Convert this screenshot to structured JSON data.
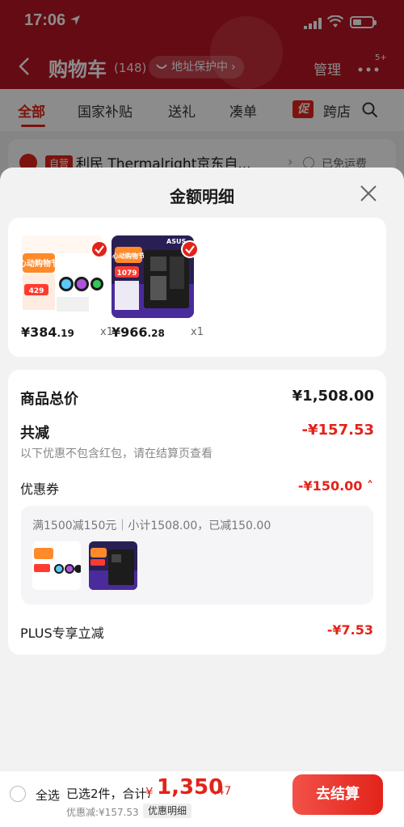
{
  "status_bar": {
    "time": "17:06"
  },
  "nav": {
    "title": "购物车",
    "count": "(148)",
    "address_label": "地址保护中",
    "manage_label": "管理",
    "more_badge": "5+"
  },
  "tabs": [
    {
      "label": "全部"
    },
    {
      "label": "国家补贴"
    },
    {
      "label": "送礼"
    },
    {
      "label": "凑单"
    },
    {
      "label": "跨店"
    }
  ],
  "promo_badge": "促",
  "store": {
    "badge": "自营",
    "name": "利民 Thermalright京东自...",
    "shipping": "已免运费"
  },
  "sheet": {
    "title": "金额明细",
    "products": [
      {
        "name": "Thermalright cooler",
        "price_int": "¥384",
        "price_dec": ".19",
        "qty": "x1",
        "img_price": "429",
        "promo": "心动购物节"
      },
      {
        "name": "ASUS TUF Gaming motherboard",
        "price_int": "¥966",
        "price_dec": ".28",
        "qty": "x1",
        "img_price": "1079",
        "promo": "心动购物节",
        "brand": "ASUS"
      }
    ],
    "summary": {
      "total_label": "商品总价",
      "total_value": "¥1,508.00",
      "reduce_label": "共减",
      "reduce_value": "-¥157.53",
      "note": "以下优惠不包含红包，请在结算页查看",
      "coupon_label": "优惠券",
      "coupon_value": "-¥150.00",
      "coupon_desc": "满1500减150元｜小计1508.00，已减150.00",
      "plus_label": "PLUS专享立减",
      "plus_value": "-¥7.53"
    }
  },
  "bottom": {
    "select_all": "全选",
    "selected_text": "已选2件，合计:",
    "total_currency": "¥",
    "total_int": "1,350",
    "total_dec": ".47",
    "discount_text": "优惠减:¥157.53",
    "detail_btn": "优惠明细",
    "checkout": "去结算"
  },
  "colors": {
    "accent": "#e2231a",
    "header": "#b81423"
  }
}
